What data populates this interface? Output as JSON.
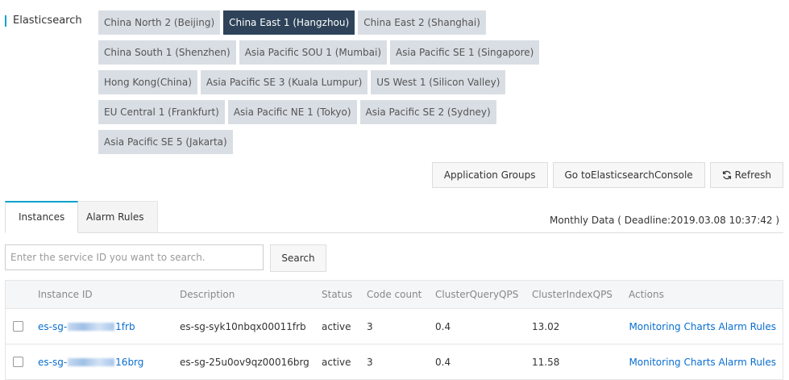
{
  "product": {
    "title": "Elasticsearch"
  },
  "regions": {
    "rows": [
      [
        {
          "label": "China North 2 (Beijing)",
          "active": false
        },
        {
          "label": "China East 1 (Hangzhou)",
          "active": true
        },
        {
          "label": "China East 2 (Shanghai)",
          "active": false
        }
      ],
      [
        {
          "label": "China South 1 (Shenzhen)",
          "active": false
        },
        {
          "label": "Asia Pacific SOU 1 (Mumbai)",
          "active": false
        },
        {
          "label": "Asia Pacific SE 1 (Singapore)",
          "active": false
        }
      ],
      [
        {
          "label": "Hong Kong(China)",
          "active": false
        },
        {
          "label": "Asia Pacific SE 3 (Kuala Lumpur)",
          "active": false
        },
        {
          "label": "US West 1 (Silicon Valley)",
          "active": false
        }
      ],
      [
        {
          "label": "EU Central 1 (Frankfurt)",
          "active": false
        },
        {
          "label": "Asia Pacific NE 1 (Tokyo)",
          "active": false
        },
        {
          "label": "Asia Pacific SE 2 (Sydney)",
          "active": false
        }
      ],
      [
        {
          "label": "Asia Pacific SE 5 (Jakarta)",
          "active": false
        }
      ]
    ]
  },
  "toolbar": {
    "app_groups": "Application Groups",
    "goto_console": "Go toElasticsearchConsole",
    "refresh": "Refresh"
  },
  "tabs": {
    "instances": "Instances",
    "alarm_rules": "Alarm Rules"
  },
  "monthly_data": "Monthly Data ( Deadline:2019.03.08 10:37:42 )",
  "search": {
    "placeholder": "Enter the service ID you want to search.",
    "button": "Search"
  },
  "table": {
    "headers": {
      "instance_id": "Instance ID",
      "description": "Description",
      "status": "Status",
      "code_count": "Code count",
      "cluster_query_qps": "ClusterQueryQPS",
      "cluster_index_qps": "ClusterIndexQPS",
      "actions": "Actions"
    },
    "rows": [
      {
        "id_prefix": "es-sg-",
        "id_suffix": "1frb",
        "description": "es-sg-syk10nbqx00011frb",
        "status": "active",
        "code_count": "3",
        "cluster_query_qps": "0.4",
        "cluster_index_qps": "13.02",
        "action_monitoring": "Monitoring Charts",
        "action_alarm": "Alarm Rules"
      },
      {
        "id_prefix": "es-sg-",
        "id_suffix": "16brg",
        "description": "es-sg-25u0ov9qz00016brg",
        "status": "active",
        "code_count": "3",
        "cluster_query_qps": "0.4",
        "cluster_index_qps": "11.58",
        "action_monitoring": "Monitoring Charts",
        "action_alarm": "Alarm Rules"
      }
    ]
  },
  "colors": {
    "accent": "#00a2ca",
    "region_active": "#2e4359",
    "region_inactive": "#d9dee4",
    "link": "#0a6ecf"
  }
}
